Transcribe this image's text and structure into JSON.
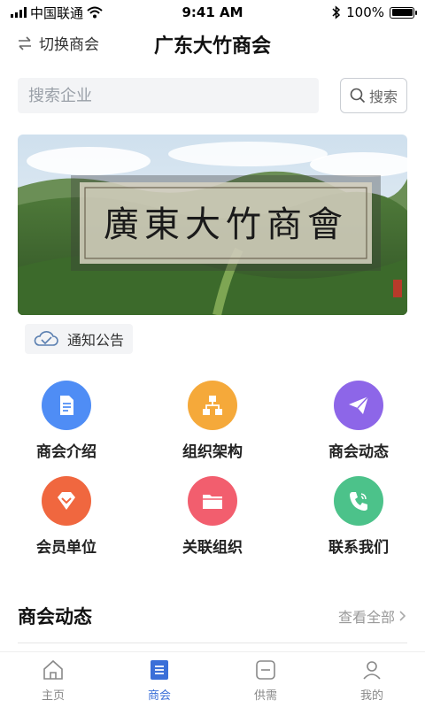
{
  "status_bar": {
    "carrier": "中国联通",
    "time": "9:41 AM",
    "battery": "100%",
    "battery_level": 1.0
  },
  "nav": {
    "switch_label": "切换商会",
    "title": "广东大竹商会"
  },
  "search": {
    "placeholder": "搜索企业",
    "button_label": "搜索"
  },
  "banner": {
    "calligraphy": "廣東大竹商會"
  },
  "notice": {
    "label": "通知公告"
  },
  "grid": [
    {
      "label": "商会介绍",
      "icon": "document-icon",
      "color": "#4f8df5"
    },
    {
      "label": "组织架构",
      "icon": "org-chart-icon",
      "color": "#f5a93a"
    },
    {
      "label": "商会动态",
      "icon": "paper-plane-icon",
      "color": "#8d66e8"
    },
    {
      "label": "会员单位",
      "icon": "diamond-icon",
      "color": "#f0673f"
    },
    {
      "label": "关联组织",
      "icon": "folder-icon",
      "color": "#f25e6e"
    },
    {
      "label": "联系我们",
      "icon": "phone-icon",
      "color": "#4cc28a"
    }
  ],
  "section": {
    "title": "商会动态",
    "more": "查看全部"
  },
  "tabs": [
    {
      "label": "主页",
      "icon": "home-icon"
    },
    {
      "label": "商会",
      "icon": "chamber-icon",
      "active": true
    },
    {
      "label": "供需",
      "icon": "supply-demand-icon"
    },
    {
      "label": "我的",
      "icon": "profile-icon"
    }
  ],
  "colors": {
    "accent": "#3a6fd8"
  }
}
